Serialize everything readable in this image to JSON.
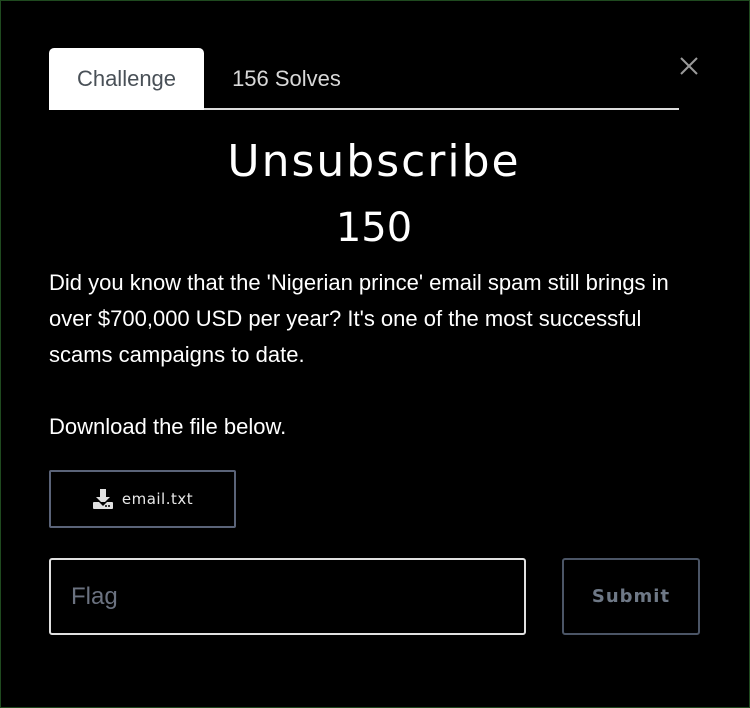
{
  "tabs": [
    {
      "label": "Challenge",
      "active": true
    },
    {
      "label": "156 Solves",
      "active": false
    }
  ],
  "close_icon": "close-icon",
  "challenge": {
    "name": "Unsubscribe",
    "points": "150",
    "description": [
      "Did you know that the 'Nigerian prince' email spam still brings in over $700,000 USD per year? It's one of the most successful scams campaigns to date.",
      "Download the file below."
    ]
  },
  "file": {
    "label": "email.txt",
    "icon": "download-icon"
  },
  "flag_input": {
    "placeholder": "Flag",
    "value": ""
  },
  "submit": {
    "label": "Submit"
  },
  "colors": {
    "background": "#000000",
    "tab_active_bg": "#ffffff",
    "tab_active_text": "#495057",
    "file_border": "#5a6378",
    "submit_border": "#4b5566",
    "submit_text": "#6e7886",
    "placeholder": "#6b7280"
  }
}
